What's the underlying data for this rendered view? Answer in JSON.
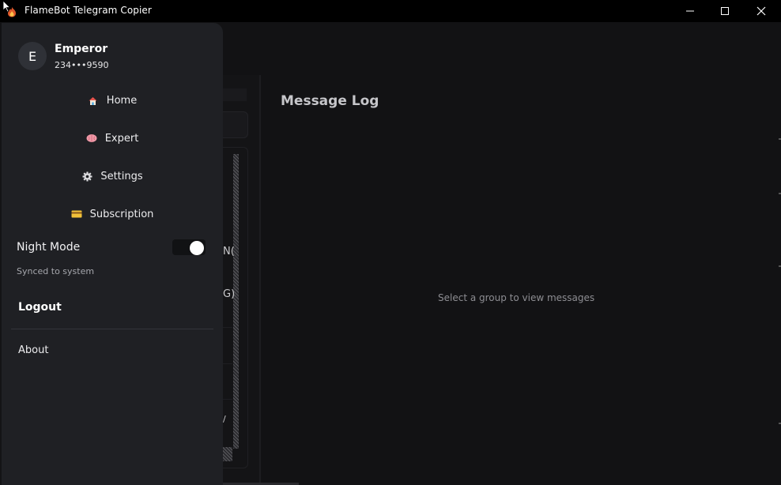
{
  "window": {
    "title": "FlameBot Telegram Copier",
    "icon": "flame-icon"
  },
  "drawer": {
    "avatar_letter": "E",
    "user_name": "Emperor",
    "user_phone": "234•••9590",
    "nav": [
      {
        "label": "Home",
        "icon": "house-icon"
      },
      {
        "label": "Expert",
        "icon": "brain-icon"
      },
      {
        "label": "Settings",
        "icon": "gear-icon"
      },
      {
        "label": "Subscription",
        "icon": "credit-card-icon"
      }
    ],
    "night_mode": {
      "label": "Night Mode",
      "on": true,
      "caption": "Synced to system"
    },
    "logout_label": "Logout",
    "about_label": "About"
  },
  "main": {
    "message_log_title": "Message Log",
    "empty_state": "Select a group to view messages",
    "list_fragments": [
      "N(",
      "G)",
      "/"
    ]
  },
  "colors": {
    "drawer_bg": "#1f2024",
    "app_bg": "#121214",
    "titlebar_bg": "#000000"
  }
}
